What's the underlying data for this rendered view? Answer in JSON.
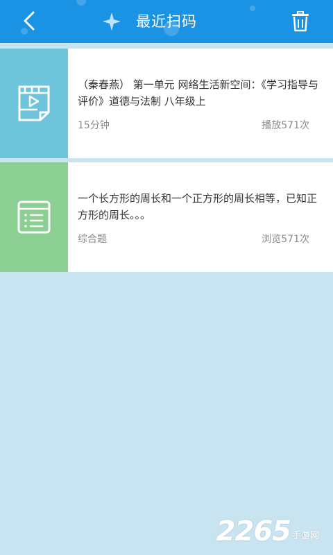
{
  "header": {
    "title": "最近扫码",
    "back_icon": "chevron-left-icon",
    "delete_icon": "trash-icon",
    "color": "#1a93e5"
  },
  "items": [
    {
      "type_icon": "video-file-icon",
      "thumb_color": "#6ec4da",
      "text": "（秦春燕） 第一单元 网络生活新空间：《学习指导与评价》道德与法制 八年级上",
      "meta_left": "15分钟",
      "meta_right": "播放571次"
    },
    {
      "type_icon": "document-list-icon",
      "thumb_color": "#8ccf92",
      "text": "一个长方形的周长和一个正方形的周长相等，已知正方形的周长。。。",
      "meta_left": "综合题",
      "meta_right": "浏览571次"
    }
  ],
  "watermark": {
    "number": "2265",
    "suffix": "手游网"
  },
  "colors": {
    "background": "#c9e4f1"
  }
}
